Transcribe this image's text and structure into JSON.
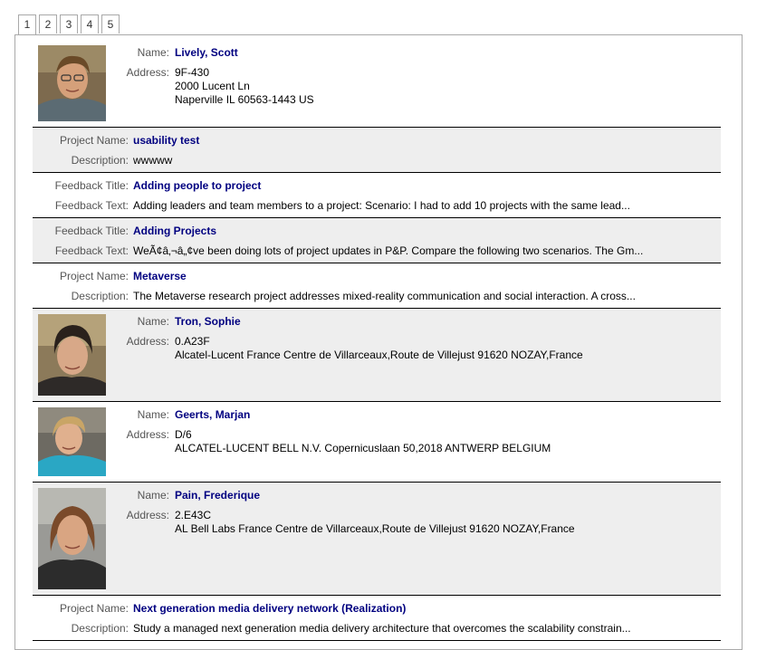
{
  "tabs": [
    "1",
    "2",
    "3",
    "4",
    "5"
  ],
  "active_tab": "1",
  "records": {
    "p1": {
      "name_label": "Name:",
      "name": "Lively, Scott",
      "address_label": "Address:",
      "address": [
        "9F-430",
        "2000 Lucent Ln",
        "Naperville IL 60563-1443 US"
      ]
    },
    "pr1": {
      "label1": "Project Name:",
      "title": "usability test",
      "label2": "Description:",
      "text": "wwwww"
    },
    "f1": {
      "label1": "Feedback Title:",
      "title": "Adding people to project",
      "label2": "Feedback Text:",
      "text": "Adding leaders and team members to a project: Scenario: I had to add 10 projects with the same lead..."
    },
    "f2": {
      "label1": "Feedback Title:",
      "title": "Adding Projects",
      "label2": "Feedback Text:",
      "text": "WeÃ¢â‚¬â„¢ve been doing lots of project updates in P&P. Compare the following two scenarios. The Gm..."
    },
    "pr2": {
      "label1": "Project Name:",
      "title": "Metaverse",
      "label2": "Description:",
      "text": "The Metaverse research project addresses mixed-reality communication and social interaction. A cross..."
    },
    "p2": {
      "name_label": "Name:",
      "name": "Tron, Sophie",
      "address_label": "Address:",
      "address": [
        "0.A23F",
        "Alcatel-Lucent France Centre de Villarceaux,Route de Villejust 91620 NOZAY,France"
      ]
    },
    "p3": {
      "name_label": "Name:",
      "name": "Geerts, Marjan",
      "address_label": "Address:",
      "address": [
        "D/6",
        "ALCATEL-LUCENT BELL N.V. Copernicuslaan 50,2018 ANTWERP BELGIUM"
      ]
    },
    "p4": {
      "name_label": "Name:",
      "name": "Pain, Frederique",
      "address_label": "Address:",
      "address": [
        "2.E43C",
        "AL Bell Labs France Centre de Villarceaux,Route de Villejust 91620 NOZAY,France"
      ]
    },
    "pr3": {
      "label1": "Project Name:",
      "title": "Next generation media delivery network (Realization)",
      "label2": "Description:",
      "text": "Study a managed next generation media delivery architecture that overcomes the scalability constrain..."
    }
  }
}
